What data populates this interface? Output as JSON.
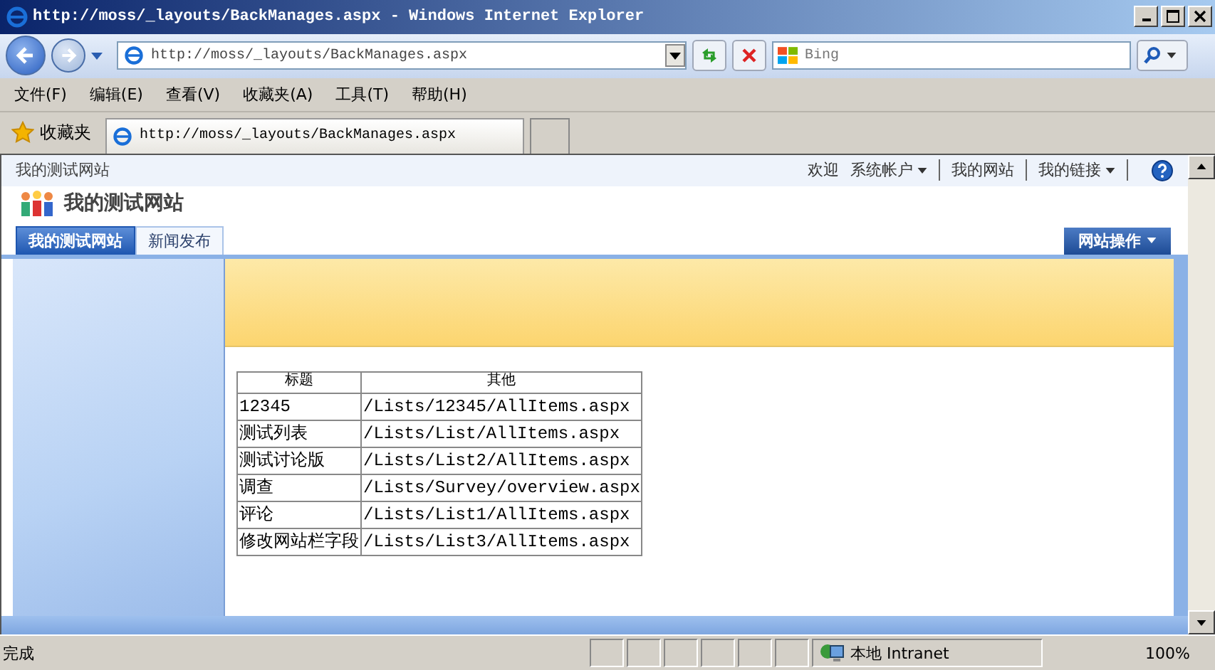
{
  "window": {
    "title": "http://moss/_layouts/BackManages.aspx - Windows Internet Explorer"
  },
  "toolbar": {
    "address": "http://moss/_layouts/BackManages.aspx",
    "search_placeholder": "Bing"
  },
  "menu": [
    "文件(F)",
    "编辑(E)",
    "查看(V)",
    "收藏夹(A)",
    "工具(T)",
    "帮助(H)"
  ],
  "favorites_bar": {
    "label": "收藏夹",
    "tab_title": "http://moss/_layouts/BackManages.aspx"
  },
  "page": {
    "breadcrumb": "我的测试网站",
    "welcome": "欢迎",
    "user_menu": "系统帐户",
    "links": [
      "我的网站",
      "我的链接"
    ],
    "site_title": "我的测试网站",
    "nav_tabs": [
      {
        "label": "我的测试网站",
        "selected": true
      },
      {
        "label": "新闻发布",
        "selected": false
      }
    ],
    "site_actions": "网站操作",
    "table": {
      "columns": [
        "标题",
        "其他"
      ],
      "rows": [
        [
          "12345",
          "/Lists/12345/AllItems.aspx"
        ],
        [
          "测试列表",
          "/Lists/List/AllItems.aspx"
        ],
        [
          "测试讨论版",
          "/Lists/List2/AllItems.aspx"
        ],
        [
          "调查",
          "/Lists/Survey/overview.aspx"
        ],
        [
          "评论",
          "/Lists/List1/AllItems.aspx"
        ],
        [
          "修改网站栏字段",
          "/Lists/List3/AllItems.aspx"
        ]
      ]
    }
  },
  "status_bar": {
    "text": "完成",
    "zone": "本地 Intranet",
    "zoom": "100%"
  }
}
